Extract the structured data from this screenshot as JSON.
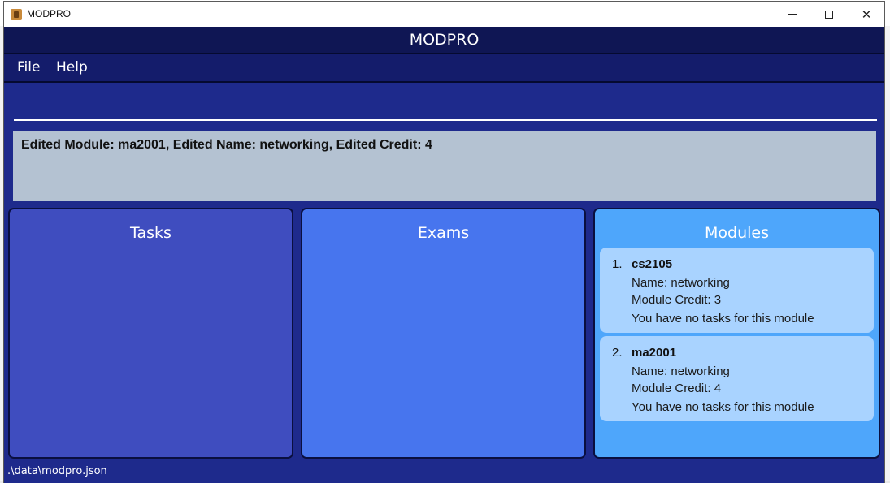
{
  "window": {
    "title": "MODPRO"
  },
  "header": {
    "title": "MODPRO"
  },
  "menu": {
    "file": "File",
    "help": "Help"
  },
  "command": {
    "value": ""
  },
  "result": {
    "text": "Edited Module: ma2001, Edited Name: networking, Edited Credit: 4"
  },
  "panels": {
    "tasks": {
      "title": "Tasks"
    },
    "exams": {
      "title": "Exams"
    },
    "modules": {
      "title": "Modules",
      "items": [
        {
          "index": "1.",
          "code": "cs2105",
          "name": "Name: networking",
          "credit": "Module Credit: 3",
          "tasks": "You have no tasks for this module"
        },
        {
          "index": "2.",
          "code": "ma2001",
          "name": "Name: networking",
          "credit": "Module Credit: 4",
          "tasks": "You have no tasks for this module"
        }
      ]
    }
  },
  "status": {
    "path": ".\\data\\modpro.json"
  },
  "colors": {
    "header_bg": "#0f1654",
    "window_bg": "#1e2a8c",
    "tasks_panel": "#3f4dbf",
    "exams_panel": "#4775ee",
    "modules_panel": "#4ea6fb",
    "module_card": "#a9d3ff",
    "result_bg": "#b4c2d2"
  }
}
